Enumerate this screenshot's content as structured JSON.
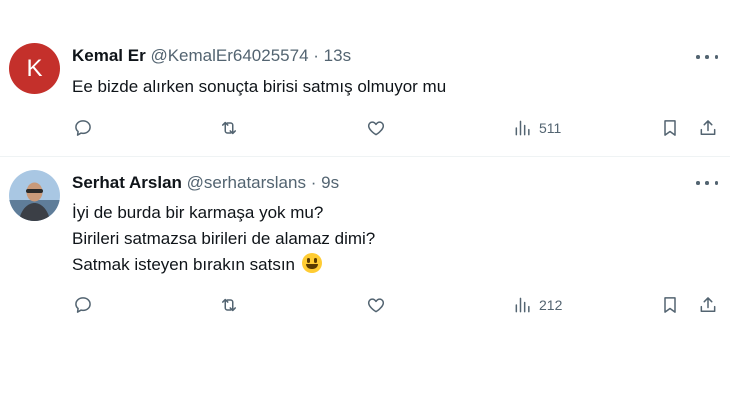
{
  "tweets": [
    {
      "avatar_letter": "K",
      "name": "Kemal Er",
      "handle": "@KemalEr64025574",
      "separator": "·",
      "time": "13s",
      "lines": [
        "Ee bizde alırken sonuçta birisi satmış olmuyor mu"
      ],
      "views": "511"
    },
    {
      "name": "Serhat Arslan",
      "handle": "@serhatarslans",
      "separator": "·",
      "time": "9s",
      "lines": [
        "İyi de burda bir karmaşa yok mu?",
        "Birileri satmazsa birileri de alamaz dimi?",
        "Satmak isteyen bırakın satsın"
      ],
      "views": "212"
    }
  ],
  "icons": [
    "more-icon",
    "reply-icon",
    "retweet-icon",
    "like-icon",
    "views-icon",
    "bookmark-icon",
    "share-icon",
    "grinning-face-emoji"
  ],
  "colors": {
    "text": "#0f1419",
    "secondary": "#536471",
    "avatar_bg": "#c4302b",
    "divider": "#eff3f4"
  }
}
